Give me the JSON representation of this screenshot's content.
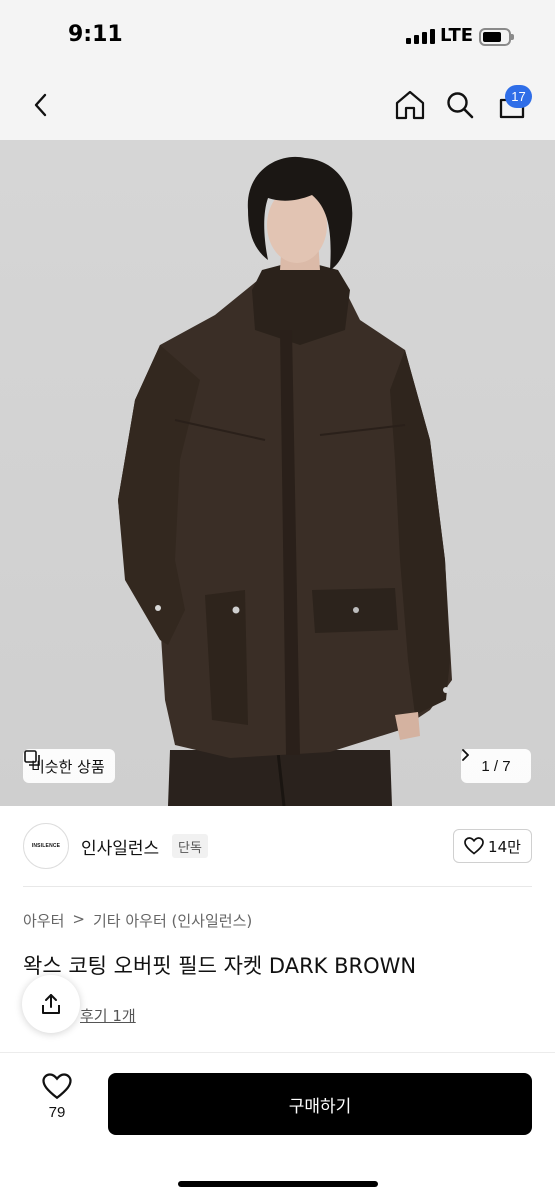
{
  "status_bar": {
    "time": "9:11",
    "network": "LTE"
  },
  "nav": {
    "back_icon": "chevron-left-icon",
    "home_icon": "home-icon",
    "search_icon": "search-icon",
    "cart_icon": "shopping-bag-icon",
    "cart_badge": "17",
    "badge_color": "#2f6ee8"
  },
  "gallery": {
    "similar_label": "비슷한 상품",
    "page_indicator": "1 / 7",
    "current_page": 1,
    "total_pages": 7
  },
  "brand": {
    "logo_text": "INSILENCE",
    "name": "인사일런스",
    "exclusive_label": "단독",
    "likes": "14만"
  },
  "product": {
    "category": [
      "아우터",
      ">",
      "기타 아우터 (인사일런스)"
    ],
    "title": "왁스 코팅 오버핏 필드 자켓 DARK BROWN",
    "review_link": "후기 1개"
  },
  "bottom": {
    "wish_count": "79",
    "buy_label": "구매하기"
  }
}
